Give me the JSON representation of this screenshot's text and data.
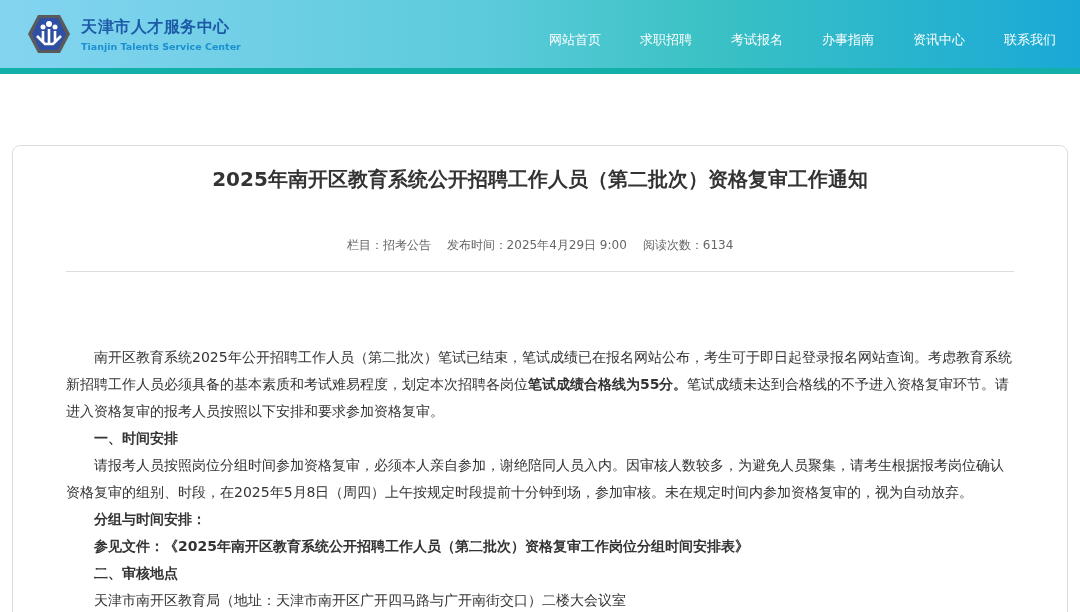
{
  "header": {
    "logo": {
      "name_cn": "天津市人才服务中心",
      "name_en": "Tianjin Talents Service Center"
    },
    "nav": [
      {
        "label": "网站首页"
      },
      {
        "label": "求职招聘"
      },
      {
        "label": "考试报名"
      },
      {
        "label": "办事指南"
      },
      {
        "label": "资讯中心"
      },
      {
        "label": "联系我们"
      }
    ]
  },
  "article": {
    "title": "2025年南开区教育系统公开招聘工作人员（第二批次）资格复审工作通知",
    "meta": [
      {
        "text": "栏目：招考公告"
      },
      {
        "text": "发布时间：2025年4月29日 9:00"
      },
      {
        "text": "阅读次数：6134"
      }
    ],
    "body": [
      {
        "kind": "paragraph",
        "text": "南开区教育系统2025年公开招聘工作人员（第二批次）笔试已结束，笔试成绩已在报名网站公布，考生可于即日起登录报名网站查询。考虑教育系统新招聘工作人员必须具备的基本素质和考试难易程度，划定本次招聘各岗位**笔试成绩合格线为55分。**笔试成绩未达到合格线的不予进入资格复审环节。请进入资格复审的报考人员按照以下安排和要求参加资格复审。"
      },
      {
        "kind": "heading",
        "text": "一、时间安排"
      },
      {
        "kind": "paragraph",
        "text": "请报考人员按照岗位分组时间参加资格复审，必须本人亲自参加，谢绝陪同人员入内。因审核人数较多，为避免人员聚集，请考生根据报考岗位确认资格复审的组别、时段，在2025年5月8日（周四）上午按规定时段提前十分钟到场，参加审核。未在规定时间内参加资格复审的，视为自动放弃。"
      },
      {
        "kind": "heading",
        "text": "分组与时间安排："
      },
      {
        "kind": "heading",
        "text": "参见文件：《2025年南开区教育系统公开招聘工作人员（第二批次）资格复审工作岗位分组时间安排表》"
      },
      {
        "kind": "heading",
        "text": "二、审核地点"
      },
      {
        "kind": "paragraph",
        "text": "天津市南开区教育局（地址：天津市南开区广开四马路与广开南街交口）二楼大会议室"
      }
    ]
  }
}
